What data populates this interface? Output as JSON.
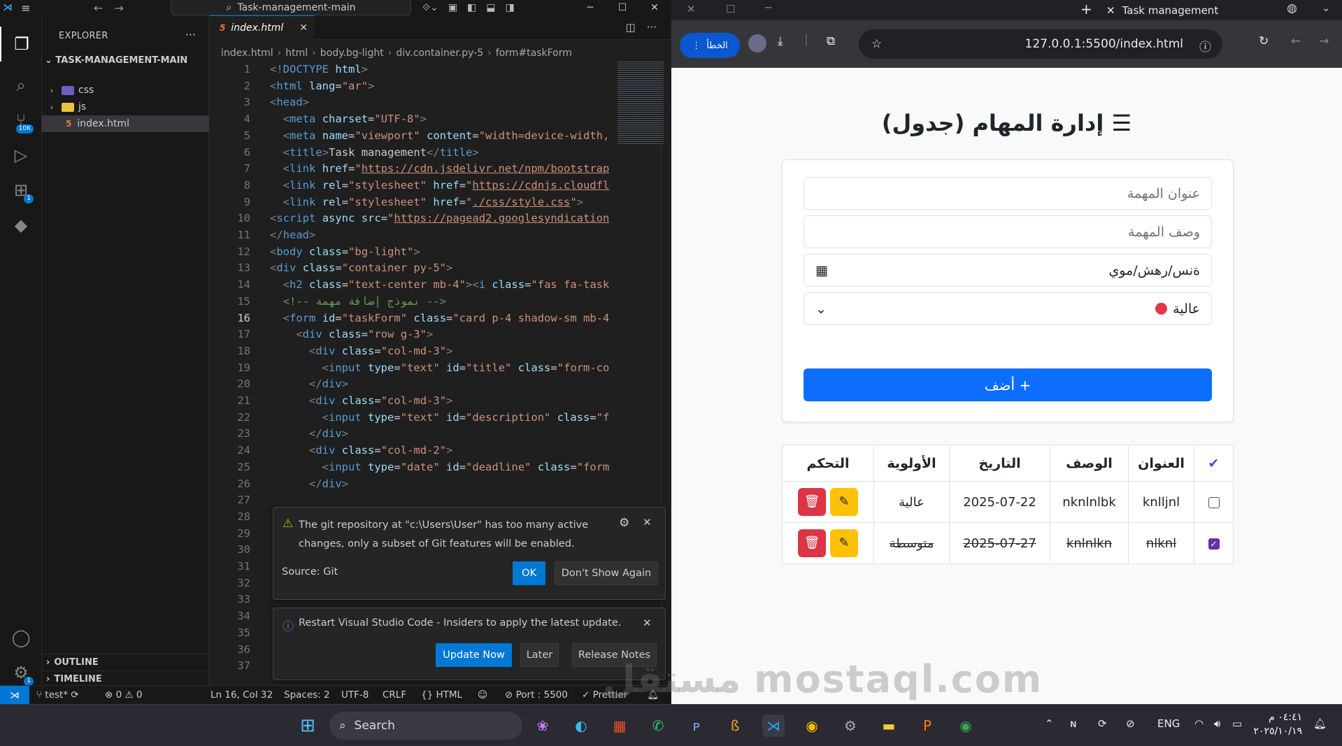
{
  "vscode": {
    "title_search": "Task-management-main",
    "explorer": {
      "title": "EXPLORER",
      "root": "TASK-MANAGEMENT-MAIN",
      "items": [
        {
          "label": "css",
          "kind": "folder"
        },
        {
          "label": "js",
          "kind": "folder"
        },
        {
          "label": "index.html",
          "kind": "file"
        }
      ],
      "outline": "OUTLINE",
      "timeline": "TIMELINE"
    },
    "activity_badges": {
      "source_control": "10K",
      "extensions": "1",
      "settings": "1"
    },
    "tab": {
      "label": "index.html"
    },
    "breadcrumb": [
      "index.html",
      "html",
      "body.bg-light",
      "div.container.py-5",
      "form#taskForm"
    ],
    "line_numbers": [
      "1",
      "2",
      "3",
      "4",
      "5",
      "6",
      "7",
      "8",
      "9",
      "10",
      "11",
      "12",
      "13",
      "14",
      "15",
      "16",
      "17",
      "18",
      "19",
      "20",
      "21",
      "22",
      "23",
      "24",
      "25",
      "26",
      "27",
      "28",
      "29",
      "30",
      "31",
      "32",
      "33",
      "34",
      "35",
      "36",
      "37"
    ],
    "current_line": "16",
    "notification_git": {
      "message": "The git repository at \"c:\\Users\\User\" has too many active changes, only a subset of Git features will be enabled.",
      "source": "Source: Git",
      "ok": "OK",
      "dont_show": "Don't Show Again"
    },
    "notification_update": {
      "message": "Restart Visual Studio Code - Insiders to apply the latest update.",
      "update_now": "Update Now",
      "later": "Later",
      "release_notes": "Release Notes"
    },
    "status": {
      "branch": "test*",
      "problems": "0",
      "warnings": "0",
      "position": "Ln 16, Col 32",
      "spaces": "Spaces: 2",
      "encoding": "UTF-8",
      "eol": "CRLF",
      "language": "HTML",
      "port": "Port : 5500",
      "prettier": "Prettier"
    }
  },
  "browser": {
    "tab_title": "Task management",
    "error_label": "الخطأ",
    "url": "127.0.0.1:5500/index.html",
    "page": {
      "heading": "إدارة المهام (جدول)",
      "title_placeholder": "عنوان المهمة",
      "description_placeholder": "وصف المهمة",
      "date_placeholder": "ةنس/رهش/موي",
      "priority_selected": "عالية",
      "add_button": "أضف +",
      "table": {
        "headers": [
          "",
          "العنوان",
          "الوصف",
          "التاريخ",
          "الأولوية",
          "التحكم"
        ],
        "rows": [
          {
            "title": "knlljnl",
            "description": "nknlnlbk",
            "date": "2025-07-22",
            "priority": "عالية",
            "done": false
          },
          {
            "title": "nlknl",
            "description": "knlnlkn",
            "date": "2025-07-27",
            "priority": "متوسطة",
            "done": true
          }
        ]
      }
    }
  },
  "taskbar": {
    "search": "Search",
    "language": "ENG",
    "time": "٠٤:٤١ م",
    "date": "٢٠٢٥/١٠/١٩"
  },
  "watermark": "مستقل mostaql.com"
}
